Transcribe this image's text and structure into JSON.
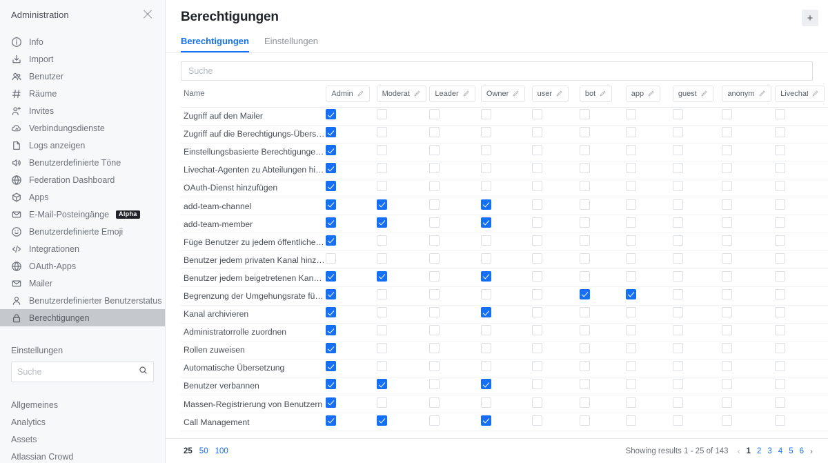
{
  "sidebar": {
    "title": "Administration",
    "close_label": "×",
    "items": [
      {
        "label": "Info",
        "icon": "info-icon"
      },
      {
        "label": "Import",
        "icon": "import-icon"
      },
      {
        "label": "Benutzer",
        "icon": "users-icon"
      },
      {
        "label": "Räume",
        "icon": "hash-icon"
      },
      {
        "label": "Invites",
        "icon": "user-plus-icon"
      },
      {
        "label": "Verbindungsdienste",
        "icon": "cloud-icon"
      },
      {
        "label": "Logs anzeigen",
        "icon": "document-icon"
      },
      {
        "label": "Benutzerdefinierte Töne",
        "icon": "sound-icon"
      },
      {
        "label": "Federation Dashboard",
        "icon": "globe-icon"
      },
      {
        "label": "Apps",
        "icon": "cube-icon"
      },
      {
        "label": "E-Mail-Posteingänge",
        "icon": "mail-icon",
        "badge": "Alpha"
      },
      {
        "label": "Benutzerdefinierte Emoji",
        "icon": "emoji-icon"
      },
      {
        "label": "Integrationen",
        "icon": "code-icon"
      },
      {
        "label": "OAuth-Apps",
        "icon": "globe-icon"
      },
      {
        "label": "Mailer",
        "icon": "mail-icon"
      },
      {
        "label": "Benutzerdefinierter Benutzerstatus",
        "icon": "user-icon"
      },
      {
        "label": "Berechtigungen",
        "icon": "lock-icon",
        "active": true
      }
    ],
    "settings_title": "Einstellungen",
    "search": {
      "placeholder": "Suche",
      "value": "",
      "icon": "search-icon"
    },
    "settings_items": [
      {
        "label": "Allgemeines"
      },
      {
        "label": "Analytics"
      },
      {
        "label": "Assets"
      },
      {
        "label": "Atlassian Crowd"
      }
    ]
  },
  "main": {
    "title": "Berechtigungen",
    "add_button": "+",
    "tabs": [
      {
        "label": "Berechtigungen",
        "active": true
      },
      {
        "label": "Einstellungen",
        "active": false
      }
    ],
    "search": {
      "placeholder": "Suche",
      "value": ""
    },
    "table": {
      "name_header": "Name",
      "roles": [
        "Admin",
        "Moderator",
        "Leader",
        "Owner",
        "user",
        "bot",
        "app",
        "guest",
        "anonymous",
        "Livechat Agent"
      ],
      "edit_icon": "pencil-icon",
      "rows": [
        {
          "name": "Zugriff auf den Mailer",
          "values": [
            1,
            0,
            0,
            0,
            0,
            0,
            0,
            0,
            0,
            0
          ]
        },
        {
          "name": "Zugriff auf die Berechtigungs-Übersicht",
          "values": [
            1,
            0,
            0,
            0,
            0,
            0,
            0,
            0,
            0,
            0
          ]
        },
        {
          "name": "Einstellungsbasierte Berechtigungen änd...",
          "values": [
            1,
            0,
            0,
            0,
            0,
            0,
            0,
            0,
            0,
            0
          ]
        },
        {
          "name": "Livechat-Agenten zu Abteilungen hinzufü...",
          "values": [
            1,
            0,
            0,
            0,
            0,
            0,
            0,
            0,
            0,
            0
          ]
        },
        {
          "name": "OAuth-Dienst hinzufügen",
          "values": [
            1,
            0,
            0,
            0,
            0,
            0,
            0,
            0,
            0,
            0
          ]
        },
        {
          "name": "add-team-channel",
          "values": [
            1,
            1,
            0,
            1,
            0,
            0,
            0,
            0,
            0,
            0
          ]
        },
        {
          "name": "add-team-member",
          "values": [
            1,
            1,
            0,
            1,
            0,
            0,
            0,
            0,
            0,
            0
          ]
        },
        {
          "name": "Füge Benutzer zu jedem öffentlichen Kan...",
          "values": [
            1,
            0,
            0,
            0,
            0,
            0,
            0,
            0,
            0,
            0
          ]
        },
        {
          "name": "Benutzer jedem privaten Kanal hinzufügen",
          "values": [
            0,
            0,
            0,
            0,
            0,
            0,
            0,
            0,
            0,
            0
          ]
        },
        {
          "name": "Benutzer jedem beigetretenen Kanal hinz...",
          "values": [
            1,
            1,
            0,
            1,
            0,
            0,
            0,
            0,
            0,
            0
          ]
        },
        {
          "name": "Begrenzung der Umgehungsrate für die ...",
          "values": [
            1,
            0,
            0,
            0,
            0,
            1,
            1,
            0,
            0,
            0
          ]
        },
        {
          "name": "Kanal archivieren",
          "values": [
            1,
            0,
            0,
            1,
            0,
            0,
            0,
            0,
            0,
            0
          ]
        },
        {
          "name": "Administratorrolle zuordnen",
          "values": [
            1,
            0,
            0,
            0,
            0,
            0,
            0,
            0,
            0,
            0
          ]
        },
        {
          "name": "Rollen zuweisen",
          "values": [
            1,
            0,
            0,
            0,
            0,
            0,
            0,
            0,
            0,
            0
          ]
        },
        {
          "name": "Automatische Übersetzung",
          "values": [
            1,
            0,
            0,
            0,
            0,
            0,
            0,
            0,
            0,
            0
          ]
        },
        {
          "name": "Benutzer verbannen",
          "values": [
            1,
            1,
            0,
            1,
            0,
            0,
            0,
            0,
            0,
            0
          ]
        },
        {
          "name": "Massen-Registrierung von Benutzern",
          "values": [
            1,
            0,
            0,
            0,
            0,
            0,
            0,
            0,
            0,
            0
          ]
        },
        {
          "name": "Call Management",
          "values": [
            1,
            1,
            0,
            1,
            0,
            0,
            0,
            0,
            0,
            0
          ]
        }
      ]
    },
    "footer": {
      "page_sizes": [
        "25",
        "50",
        "100"
      ],
      "page_size_selected": "25",
      "showing": "Showing results 1 - 25 of 143",
      "prev_arrow": "‹",
      "next_arrow": "›",
      "pages": [
        "1",
        "2",
        "3",
        "4",
        "5",
        "6"
      ],
      "current_page": "1"
    }
  },
  "colors": {
    "accent": "#156ff5",
    "sidebar_bg": "#f7f8fa",
    "active_item_bg": "#c5c8cc",
    "badge_bg": "#1f2329"
  }
}
